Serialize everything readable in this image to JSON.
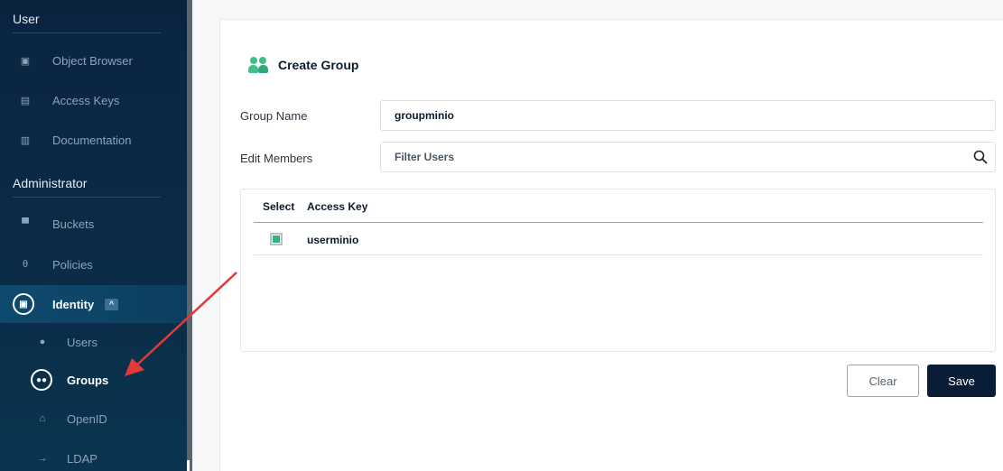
{
  "sidebar": {
    "sections": [
      {
        "title": "User"
      },
      {
        "title": "Administrator"
      }
    ],
    "user_items": [
      {
        "label": "Object Browser",
        "icon": "object-browser-icon"
      },
      {
        "label": "Access Keys",
        "icon": "access-keys-icon"
      },
      {
        "label": "Documentation",
        "icon": "documentation-icon"
      }
    ],
    "admin_items": [
      {
        "label": "Buckets",
        "icon": "buckets-icon"
      },
      {
        "label": "Policies",
        "icon": "policies-icon"
      },
      {
        "label": "Identity",
        "icon": "identity-icon",
        "expanded": true
      }
    ],
    "identity_subitems": [
      {
        "label": "Users",
        "icon": "user-icon"
      },
      {
        "label": "Groups",
        "icon": "groups-icon",
        "active": true
      },
      {
        "label": "OpenID",
        "icon": "lock-icon"
      },
      {
        "label": "LDAP",
        "icon": "login-icon"
      }
    ]
  },
  "main": {
    "title": "Create Group",
    "group_name_label": "Group Name",
    "group_name_value": "groupminio",
    "edit_members_label": "Edit Members",
    "filter_placeholder": "Filter Users",
    "table": {
      "columns": [
        "Select",
        "Access Key"
      ],
      "rows": [
        {
          "selected": true,
          "access_key": "userminio"
        }
      ]
    },
    "clear_label": "Clear",
    "save_label": "Save"
  },
  "colors": {
    "sidebar_bg": "#0a2440",
    "accent_green": "#2fb67a",
    "save_bg": "#0a1d37",
    "annotation_arrow": "#e53935"
  }
}
